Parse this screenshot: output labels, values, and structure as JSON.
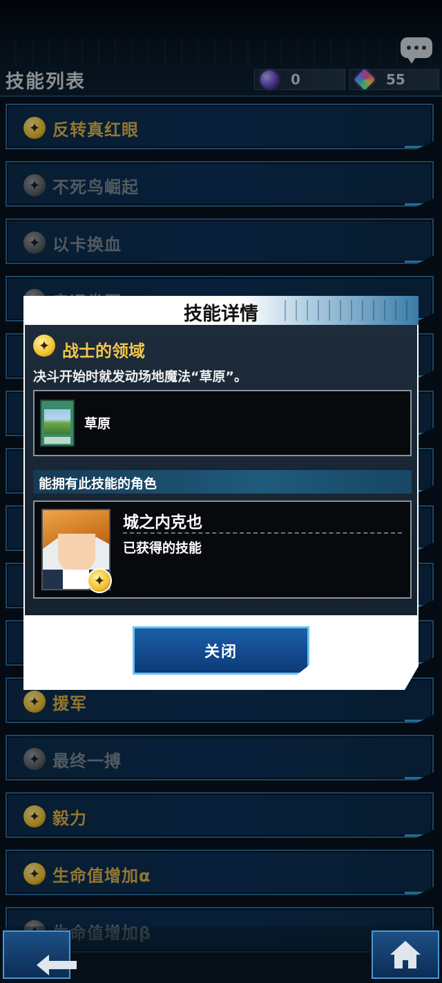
{
  "header": {
    "title": "技能列表",
    "currency1": {
      "icon": "orb-gem-icon",
      "value": "0"
    },
    "currency2": {
      "icon": "rainbow-gem-icon",
      "value": "55"
    }
  },
  "skills": [
    {
      "label": "反转真红眼",
      "state": "gold"
    },
    {
      "label": "不死鸟崛起",
      "state": "gray"
    },
    {
      "label": "以卡换血",
      "state": "gray"
    },
    {
      "label": "幸运拳匠",
      "state": "gray"
    },
    {
      "label": "",
      "state": "gold"
    },
    {
      "label": "",
      "state": "gold"
    },
    {
      "label": "",
      "state": "gold"
    },
    {
      "label": "",
      "state": "gold"
    },
    {
      "label": "",
      "state": "gold"
    },
    {
      "label": "",
      "state": "gold"
    },
    {
      "label": "援军",
      "state": "gold"
    },
    {
      "label": "最终一搏",
      "state": "gray"
    },
    {
      "label": "毅力",
      "state": "gold"
    },
    {
      "label": "生命值增加α",
      "state": "gold"
    },
    {
      "label": "生命值增加β",
      "state": "gray"
    }
  ],
  "modal": {
    "title": "技能详情",
    "skill_name": "战士的领域",
    "skill_desc": "决斗开始时就发动场地魔法“草原”。",
    "card_name": "草原",
    "owners_header": "能拥有此技能的角色",
    "owner_name": "城之内克也",
    "owner_status": "已获得的技能",
    "close_label": "关闭"
  }
}
